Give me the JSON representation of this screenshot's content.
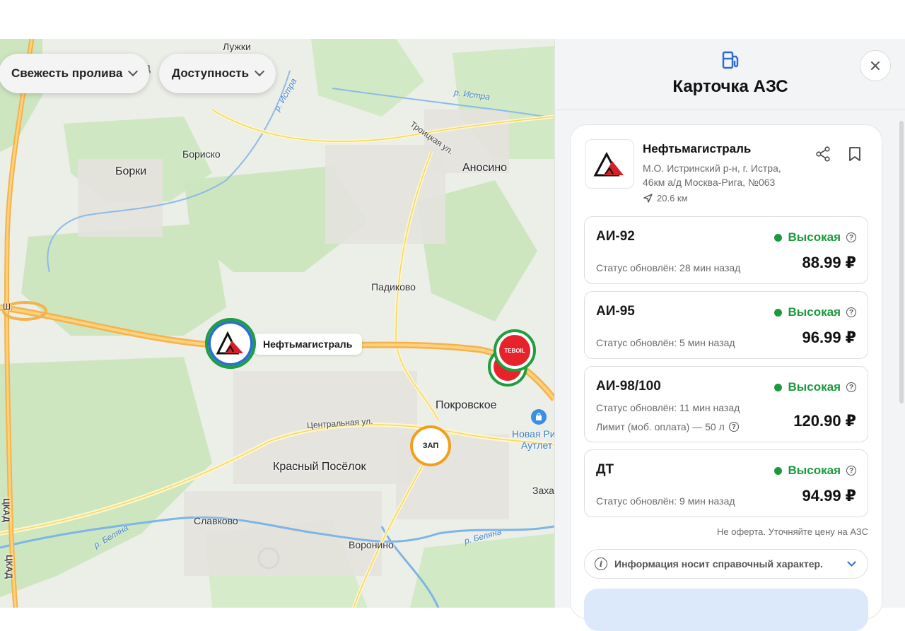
{
  "map": {
    "filters": [
      {
        "label": "Свежесть пролива"
      },
      {
        "label": "Доступность"
      }
    ],
    "places": {
      "luzhki": "Лужки",
      "borisovo": "Бориско",
      "borki": "Борки",
      "anosino": "Аносино",
      "padikovo": "Падиково",
      "pokrovskoe": "Покровское",
      "krasny": "Красный Посёлок",
      "slavkovo": "Славково",
      "voronino": "Воронино",
      "outlet1": "Новая Ри",
      "outlet2": "Аутлет",
      "zakh": "Заха",
      "id": "ИД",
      "sh": "Ш."
    },
    "rivers": {
      "istra1": "р. Истра",
      "istra2": "р. Истра",
      "belyana1": "р. Беляна",
      "belyana2": "р. Беляна"
    },
    "roads": {
      "troitskaya": "Троицкая ул.",
      "centralnaya": "Центральная ул.",
      "ckad1": "ЦКАД",
      "ckad2": "ЦКАД"
    },
    "markers": {
      "selected_label": "Нефтьмагистраль",
      "tebol": "TEBOIL",
      "zap": "ЗАП"
    }
  },
  "panel": {
    "title": "Карточка АЗС",
    "station": {
      "name": "Нефтьмагистраль",
      "address": "М.О. Истринский р-н, г. Истра, 46км а/д Москва-Рига, №063",
      "distance": "20.6 км"
    },
    "fuels": [
      {
        "name": "АИ-92",
        "status": "Высокая",
        "updated": "Статус обновлён: 28 мин назад",
        "price": "88.99 ₽"
      },
      {
        "name": "АИ-95",
        "status": "Высокая",
        "updated": "Статус обновлён: 5 мин назад",
        "price": "96.99 ₽"
      },
      {
        "name": "АИ-98/100",
        "status": "Высокая",
        "updated": "Статус обновлён: 11 мин назад",
        "limit": "Лимит (моб. оплата) — 50 л",
        "price": "120.90 ₽"
      },
      {
        "name": "ДТ",
        "status": "Высокая",
        "updated": "Статус обновлён: 9 мин назад",
        "price": "94.99 ₽"
      }
    ],
    "disclaimer": "Не оферта. Уточняйте цену на АЗС",
    "info": "Информация носит справочный характер.",
    "question_glyph": "?",
    "info_glyph": "i"
  },
  "colors": {
    "status_green": "#1a9a3c",
    "accent_blue": "#2b6cd4",
    "marker_green": "#1f9e3e",
    "marker_orange": "#f0a020",
    "tebol_red": "#e8222a"
  },
  "icons": [
    "fuel-pump-icon",
    "close-icon",
    "share-icon",
    "bookmark-icon",
    "navigation-arrow-icon",
    "question-icon",
    "info-icon",
    "chevron-down-icon"
  ]
}
